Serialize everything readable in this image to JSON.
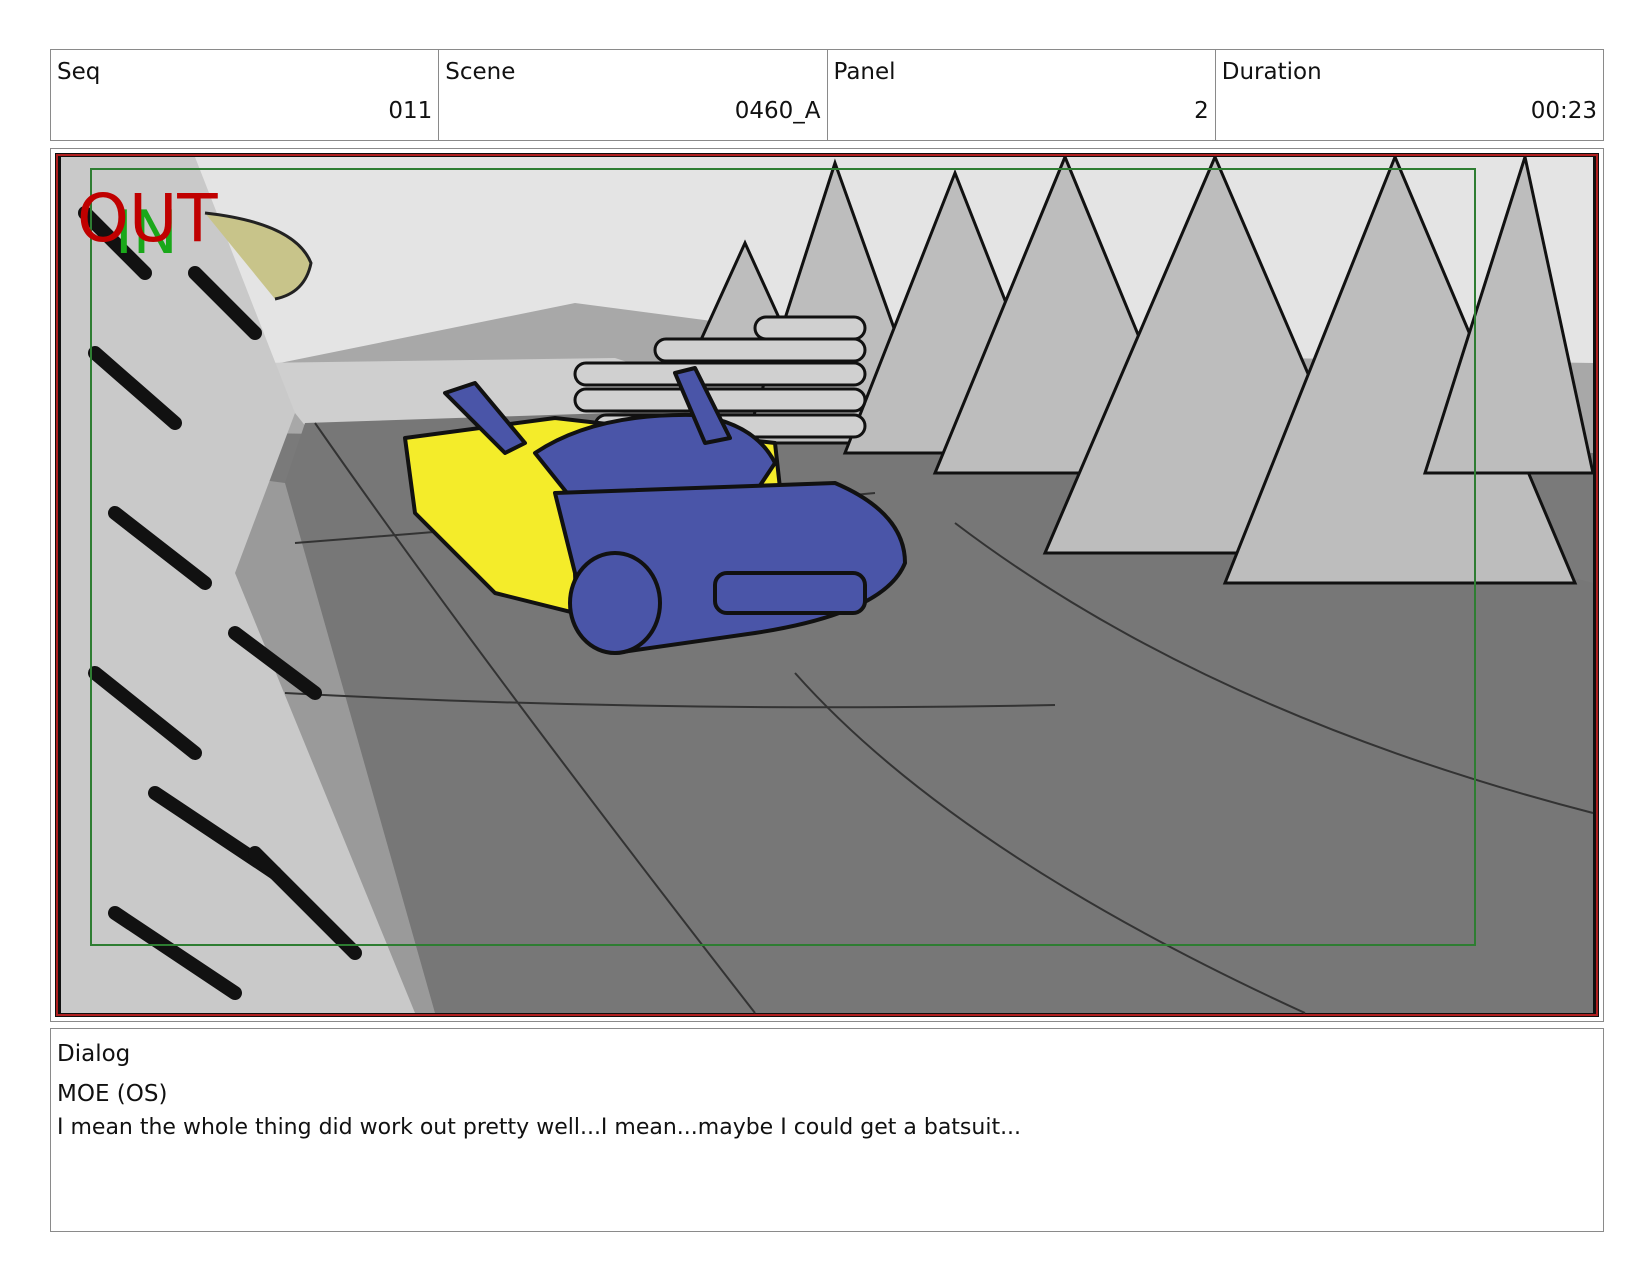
{
  "header": {
    "seq_label": "Seq",
    "seq_value": "011",
    "scene_label": "Scene",
    "scene_value": "0460_A",
    "panel_label": "Panel",
    "panel_value": "2",
    "duration_label": "Duration",
    "duration_value": "00:23"
  },
  "panel": {
    "overlay_out": "OUT",
    "overlay_in": "IN",
    "colors": {
      "out": "#c00000",
      "in": "#1aa81a",
      "car_body": "#4a55a8",
      "car_trim": "#f4ec2a",
      "safe_frame": "#2e7d32"
    }
  },
  "dialog": {
    "title": "Dialog",
    "speaker": "MOE (OS)",
    "line": "I mean the whole thing did work out pretty well...I mean...maybe I could get a batsuit..."
  }
}
